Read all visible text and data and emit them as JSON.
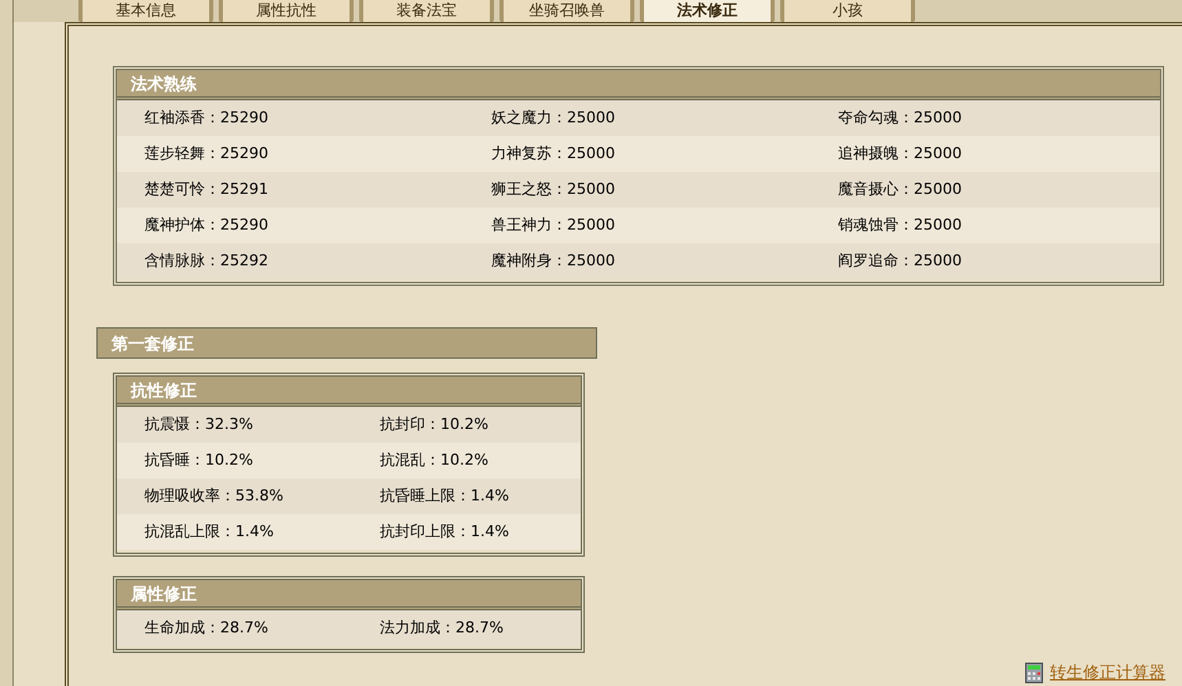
{
  "tabs": [
    {
      "label": "基本信息",
      "selected": false
    },
    {
      "label": "属性抗性",
      "selected": false
    },
    {
      "label": "装备法宝",
      "selected": false
    },
    {
      "label": "坐骑召唤兽",
      "selected": false
    },
    {
      "label": "法术修正",
      "selected": true
    },
    {
      "label": "小孩",
      "selected": false
    }
  ],
  "skills": {
    "title": "法术熟练",
    "rows": [
      [
        "红袖添香：25290",
        "妖之魔力：25000",
        "夺命勾魂：25000"
      ],
      [
        "莲步轻舞：25290",
        "力神复苏：25000",
        "追神摄魄：25000"
      ],
      [
        "楚楚可怜：25291",
        "狮王之怒：25000",
        "魔音摄心：25000"
      ],
      [
        "魔神护体：25290",
        "兽王神力：25000",
        "销魂蚀骨：25000"
      ],
      [
        "含情脉脉：25292",
        "魔神附身：25000",
        "阎罗追命：25000"
      ]
    ]
  },
  "set": {
    "title": "第一套修正",
    "panels": [
      {
        "title": "抗性修正",
        "rows": [
          [
            "抗震慑：32.3%",
            "抗封印：10.2%"
          ],
          [
            "抗昏睡：10.2%",
            "抗混乱：10.2%"
          ],
          [
            "物理吸收率：53.8%",
            "抗昏睡上限：1.4%"
          ],
          [
            "抗混乱上限：1.4%",
            "抗封印上限：1.4%"
          ]
        ]
      },
      {
        "title": "属性修正",
        "rows": [
          [
            "生命加成：28.7%",
            "法力加成：28.7%"
          ]
        ]
      }
    ]
  },
  "calculator_link": "转生修正计算器"
}
